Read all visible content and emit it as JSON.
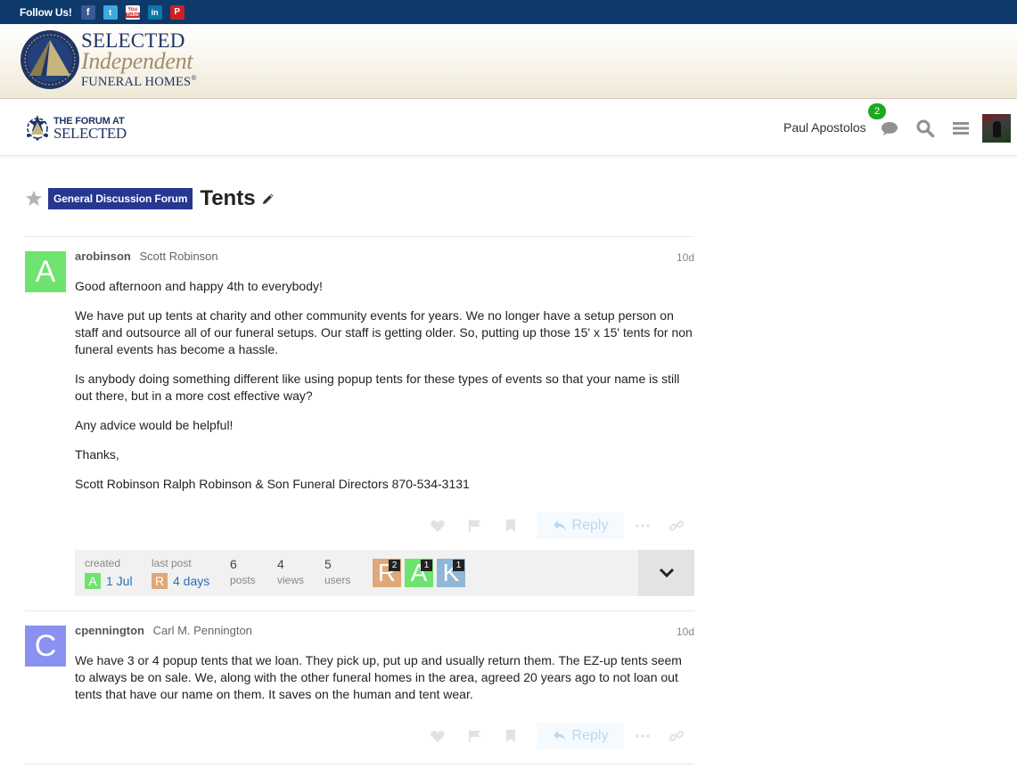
{
  "follow": {
    "label": "Follow Us!",
    "icons": [
      {
        "name": "facebook-icon",
        "glyph": "f"
      },
      {
        "name": "twitter-icon",
        "glyph": "t"
      },
      {
        "name": "youtube-icon",
        "glyph_top": "You",
        "glyph_bottom": "Tube"
      },
      {
        "name": "linkedin-icon",
        "glyph": "in"
      },
      {
        "name": "pinterest-icon",
        "glyph": "P"
      }
    ]
  },
  "banner": {
    "line1": "SELECTED",
    "line2": "Independent",
    "line3": "FUNERAL HOMES",
    "reg": "®"
  },
  "header": {
    "forum_logo_line1": "THE FORUM AT",
    "forum_logo_line2": "SELECTED",
    "username": "Paul Apostolos",
    "notification_count": "2"
  },
  "topic": {
    "category": "General Discussion Forum",
    "category_color": "#25378f",
    "title": "Tents"
  },
  "posts": [
    {
      "username": "arobinson",
      "full_name": "Scott Robinson",
      "age": "10d",
      "avatar_letter": "A",
      "avatar_color": "#6fe36f",
      "paragraphs": [
        "Good afternoon and happy 4th to everybody!",
        "We have put up tents at charity and other community events for years. We no longer have a setup person on staff and outsource all of our funeral setups. Our staff is getting older. So, putting up those 15' x 15' tents for non funeral events has become a hassle.",
        "Is anybody doing something different like using popup tents for these types of events so that your name is still out there, but in a more cost effective way?",
        "Any advice would be helpful!",
        "Thanks,",
        "Scott Robinson Ralph Robinson & Son Funeral Directors 870-534-3131"
      ],
      "reply_label": "Reply"
    },
    {
      "username": "cpennington",
      "full_name": "Carl M. Pennington",
      "age": "10d",
      "avatar_letter": "C",
      "avatar_color": "#8b91f0",
      "paragraphs": [
        "We have 3 or 4 popup tents that we loan. They pick up, put up and usually return them. The EZ-up tents seem to always be on sale. We, along with the other funeral homes in the area, agreed 20 years ago to not loan out tents that have our name on them. It saves on the human and tent wear."
      ],
      "reply_label": "Reply"
    }
  ],
  "topic_map": {
    "created_label": "created",
    "created_value": "1 Jul",
    "created_avatar_letter": "A",
    "created_avatar_color": "#6fe36f",
    "last_post_label": "last post",
    "last_post_value": "4 days",
    "last_post_avatar_letter": "R",
    "last_post_avatar_color": "#e0a878",
    "posts_count": "6",
    "posts_label": "posts",
    "views_count": "4",
    "views_label": "views",
    "users_count": "5",
    "users_label": "users",
    "participants": [
      {
        "letter": "R",
        "count": "2",
        "color": "#e0a878"
      },
      {
        "letter": "A",
        "count": "1",
        "color": "#6fe36f"
      },
      {
        "letter": "K",
        "count": "1",
        "color": "#8fb8d8"
      }
    ]
  }
}
